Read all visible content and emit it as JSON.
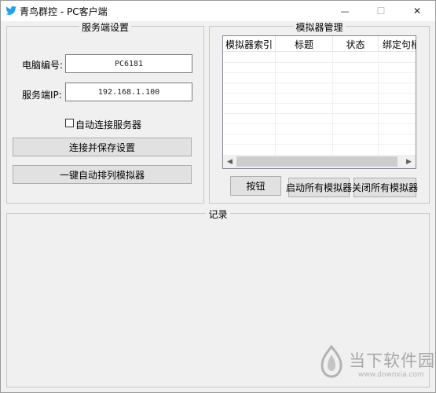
{
  "window": {
    "title": "青鸟群控 - PC客户端",
    "minimize_glyph": "—",
    "maximize_glyph": "☐",
    "close_glyph": "✕"
  },
  "server_settings": {
    "title": "服务端设置",
    "pc_number_label": "电脑编号:",
    "pc_number_value": "PC6181",
    "server_ip_label": "服务端IP:",
    "server_ip_value": "192.168.1.100",
    "auto_connect_label": "自动连接服务器",
    "auto_connect_checked": false,
    "connect_save_button": "连接并保存设置",
    "auto_arrange_button": "一键自动排列模拟器"
  },
  "emulator_management": {
    "title": "模拟器管理",
    "columns": [
      "模拟器索引",
      "标题",
      "状态",
      "绑定句柄"
    ],
    "rows": [],
    "scroll_left": "◀",
    "scroll_right": "▶",
    "button_label": "按钮",
    "start_all_button": "启动所有模拟器",
    "close_all_button": "关闭所有模拟器"
  },
  "log": {
    "title": "记录"
  },
  "watermark": {
    "text": "当下软件园",
    "url": "www.downxia.com"
  },
  "colors": {
    "window_bg": "#f0f0f0",
    "button_bg": "#e1e1e1",
    "title_icon": "#1da1f2",
    "watermark": "#a8a8a8"
  }
}
